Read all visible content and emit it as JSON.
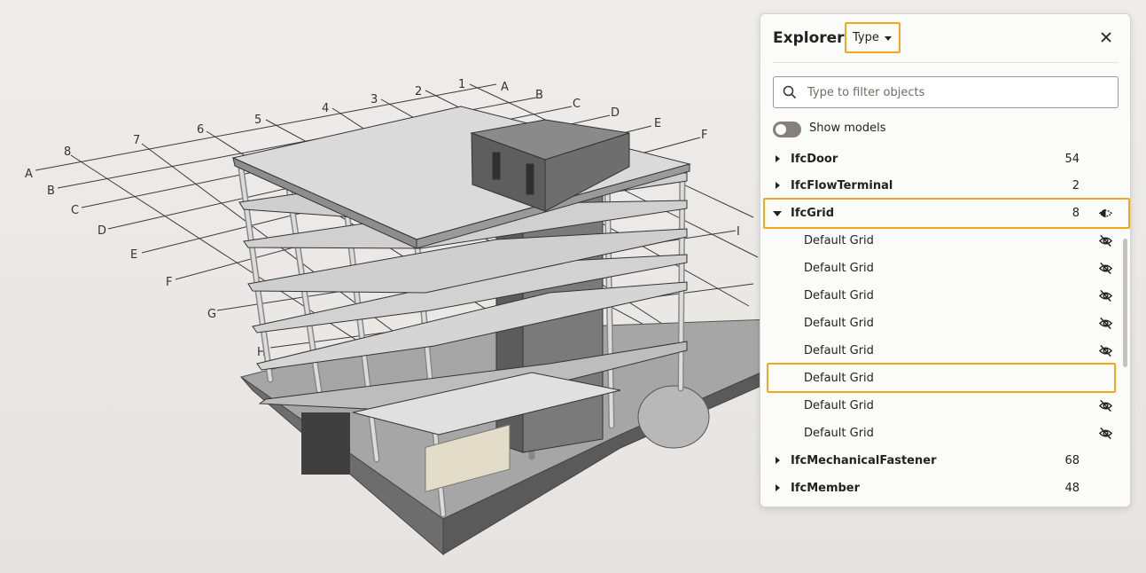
{
  "viewport": {
    "grid_letters": [
      "A",
      "B",
      "C",
      "D",
      "E",
      "F",
      "G",
      "H",
      "I"
    ],
    "grid_numbers": [
      "1",
      "2",
      "3",
      "4",
      "5",
      "6",
      "7",
      "8"
    ]
  },
  "explorer": {
    "title": "Explorer",
    "type_select": {
      "value": "Type"
    },
    "search": {
      "placeholder": "Type to filter objects"
    },
    "show_models": {
      "label": "Show models",
      "checked": false
    },
    "tree": [
      {
        "label": "IfcDoor",
        "count": "54",
        "expanded": false
      },
      {
        "label": "IfcFlowTerminal",
        "count": "2",
        "expanded": false
      },
      {
        "label": "IfcGrid",
        "count": "8",
        "expanded": true,
        "children": [
          {
            "label": "Default Grid",
            "visible": false
          },
          {
            "label": "Default Grid",
            "visible": false
          },
          {
            "label": "Default Grid",
            "visible": false
          },
          {
            "label": "Default Grid",
            "visible": false
          },
          {
            "label": "Default Grid",
            "visible": false
          },
          {
            "label": "Default Grid",
            "visible": true
          },
          {
            "label": "Default Grid",
            "visible": false
          },
          {
            "label": "Default Grid",
            "visible": false
          }
        ]
      },
      {
        "label": "IfcMechanicalFastener",
        "count": "68",
        "expanded": false
      },
      {
        "label": "IfcMember",
        "count": "48",
        "expanded": false
      }
    ]
  },
  "colors": {
    "highlight": "#f2a81d",
    "panel_bg": "#fbfbfa",
    "slab": "#d8d8d8",
    "core": "#7a7a7a"
  }
}
